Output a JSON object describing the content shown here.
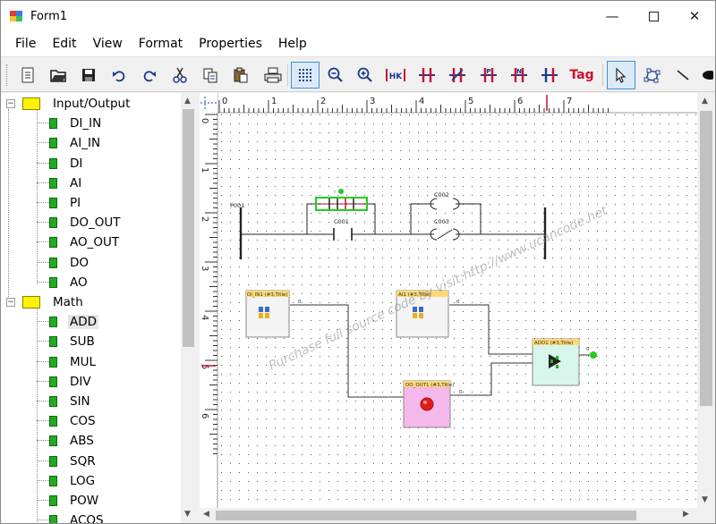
{
  "window": {
    "title": "Form1"
  },
  "menu": {
    "items": [
      "File",
      "Edit",
      "View",
      "Format",
      "Properties",
      "Help"
    ]
  },
  "toolbar": {
    "buttons": [
      {
        "name": "new-icon"
      },
      {
        "name": "open-icon"
      },
      {
        "name": "save-icon"
      },
      {
        "name": "undo-icon"
      },
      {
        "name": "redo-icon"
      },
      {
        "name": "cut-icon"
      },
      {
        "name": "copy-icon"
      },
      {
        "name": "paste-icon"
      },
      {
        "name": "print-icon"
      },
      {
        "name": "grid-icon"
      },
      {
        "name": "zoom-out-icon"
      },
      {
        "name": "zoom-in-icon"
      },
      {
        "name": "contact-hk-icon"
      },
      {
        "name": "contact-no-icon"
      },
      {
        "name": "contact-nc-icon"
      },
      {
        "name": "contact-p-icon"
      },
      {
        "name": "contact-n-icon"
      },
      {
        "name": "coil-icon"
      },
      {
        "name": "tag-icon"
      },
      {
        "name": "pointer-icon"
      },
      {
        "name": "polyline-icon"
      },
      {
        "name": "line-icon"
      },
      {
        "name": "ellipse-icon"
      }
    ],
    "tag_label": "Tag"
  },
  "tree": {
    "groups": [
      {
        "label": "Input/Output",
        "items": [
          "DI_IN",
          "AI_IN",
          "DI",
          "AI",
          "PI",
          "DO_OUT",
          "AO_OUT",
          "DO",
          "AO"
        ]
      },
      {
        "label": "Math",
        "items": [
          "ADD",
          "SUB",
          "MUL",
          "DIV",
          "SIN",
          "COS",
          "ABS",
          "SQR",
          "LOG",
          "POW",
          "ACOS"
        ]
      }
    ],
    "selected": "ADD"
  },
  "ruler": {
    "h_ticks": [
      "0",
      "1",
      "2",
      "3",
      "4",
      "5",
      "6",
      "7"
    ],
    "v_ticks": [
      "0",
      "1",
      "2",
      "3",
      "4",
      "5",
      "6"
    ]
  },
  "diagram": {
    "rung_label": "P001",
    "contacts": [
      "C001",
      "C002",
      "C003"
    ],
    "blocks": [
      {
        "title": "DI_IN1 (#3,Title)",
        "port": "0"
      },
      {
        "title": "AI1 (#3,Title)",
        "port": "0"
      },
      {
        "title": "ADD1 (#3,Title)",
        "port": "0"
      },
      {
        "title": "DO_OUT1 (#3,Title)",
        "port": "0"
      }
    ],
    "watermark": "Purchase full source code by visit:http://www.ucancode.net"
  },
  "colors": {
    "accent": "#3d8fdd",
    "folder": "#fff200",
    "leaf": "#22aa22",
    "coil": "#c8102e"
  }
}
